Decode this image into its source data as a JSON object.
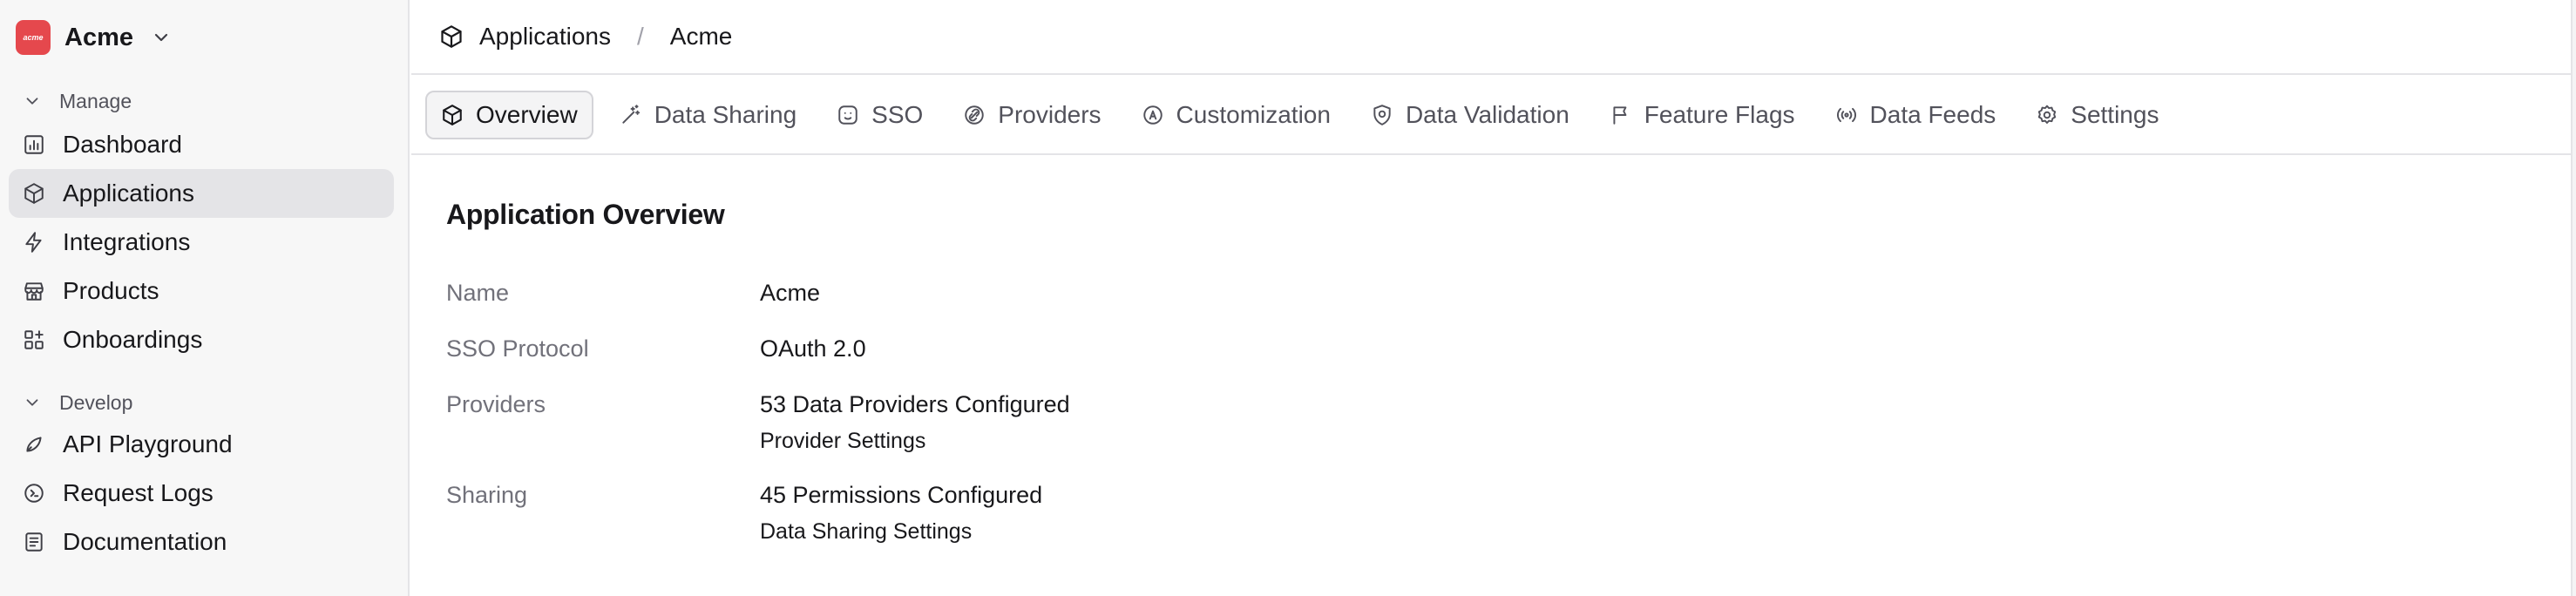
{
  "org": {
    "name": "Acme",
    "logo_text": "acme"
  },
  "sidebar": {
    "manage_title": "Manage",
    "manage_items": [
      {
        "label": "Dashboard",
        "icon": "bar-chart-icon"
      },
      {
        "label": "Applications",
        "icon": "cube-icon",
        "active": true
      },
      {
        "label": "Integrations",
        "icon": "lightning-icon"
      },
      {
        "label": "Products",
        "icon": "store-icon"
      },
      {
        "label": "Onboardings",
        "icon": "grid-plus-icon"
      }
    ],
    "develop_title": "Develop",
    "develop_items": [
      {
        "label": "API Playground",
        "icon": "rocket-icon"
      },
      {
        "label": "Request Logs",
        "icon": "terminal-icon"
      },
      {
        "label": "Documentation",
        "icon": "book-icon"
      }
    ]
  },
  "breadcrumb": {
    "root": "Applications",
    "current": "Acme",
    "separator": "/"
  },
  "tabs": [
    {
      "label": "Overview",
      "icon": "cube-icon",
      "active": true
    },
    {
      "label": "Data Sharing",
      "icon": "wand-icon"
    },
    {
      "label": "SSO",
      "icon": "smiley-icon"
    },
    {
      "label": "Providers",
      "icon": "link-icon"
    },
    {
      "label": "Customization",
      "icon": "at-icon"
    },
    {
      "label": "Data Validation",
      "icon": "shield-icon"
    },
    {
      "label": "Feature Flags",
      "icon": "flag-icon"
    },
    {
      "label": "Data Feeds",
      "icon": "broadcast-icon"
    },
    {
      "label": "Settings",
      "icon": "gear-icon"
    }
  ],
  "overview": {
    "title": "Application Overview",
    "rows": [
      {
        "label": "Name",
        "value": "Acme"
      },
      {
        "label": "SSO Protocol",
        "value": "OAuth 2.0"
      },
      {
        "label": "Providers",
        "value": "53 Data Providers Configured",
        "link": "Provider Settings"
      },
      {
        "label": "Sharing",
        "value": "45 Permissions Configured",
        "link": "Data Sharing Settings"
      }
    ]
  },
  "colors": {
    "brand": "#e5484d",
    "active_bg": "#e4e4e7",
    "muted_text": "#71717a"
  }
}
